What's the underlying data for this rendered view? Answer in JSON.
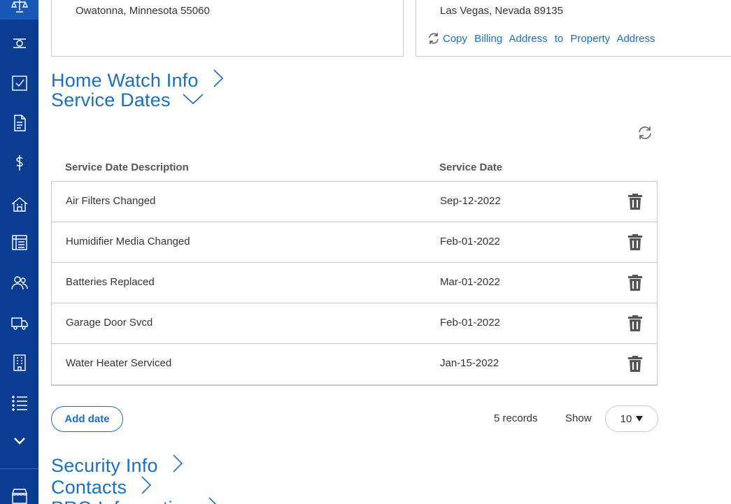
{
  "sidebar": {
    "items": [
      {
        "icon": "scale-icon"
      },
      {
        "icon": "drone-icon"
      },
      {
        "icon": "checkbox-icon"
      },
      {
        "icon": "invoice-icon"
      },
      {
        "icon": "dollar-icon"
      },
      {
        "icon": "property-icon"
      },
      {
        "icon": "ledger-icon"
      },
      {
        "icon": "people-icon"
      },
      {
        "icon": "truck-icon"
      },
      {
        "icon": "building-icon"
      },
      {
        "icon": "list-icon"
      },
      {
        "icon": "chevron-down-icon"
      },
      {
        "icon": "store-icon"
      }
    ]
  },
  "billing_address": {
    "city_line": "Owatonna, Minnesota 55060"
  },
  "property_address": {
    "city_line": "Las Vegas, Nevada 89135",
    "copy_link": "Copy Billing Address to Property Address"
  },
  "sections": {
    "home_watch": "Home Watch Info",
    "service_dates": "Service Dates",
    "security": "Security Info",
    "contacts": "Contacts",
    "pro_info": "PRO Information"
  },
  "service_dates": {
    "columns": {
      "description": "Service Date Description",
      "date": "Service Date"
    },
    "rows": [
      {
        "description": "Air Filters Changed",
        "date": "Sep-12-2022"
      },
      {
        "description": "Humidifier Media Changed",
        "date": "Feb-01-2022"
      },
      {
        "description": "Batteries Replaced",
        "date": "Mar-01-2022"
      },
      {
        "description": "Garage Door Svcd",
        "date": "Feb-01-2022"
      },
      {
        "description": "Water Heater Serviced",
        "date": "Jan-15-2022"
      }
    ],
    "add_label": "Add date",
    "records": "5 records",
    "show_label": "Show",
    "page_size": "10"
  },
  "colors": {
    "sidebar": "#0a3d91",
    "accent": "#1a6fbf"
  }
}
